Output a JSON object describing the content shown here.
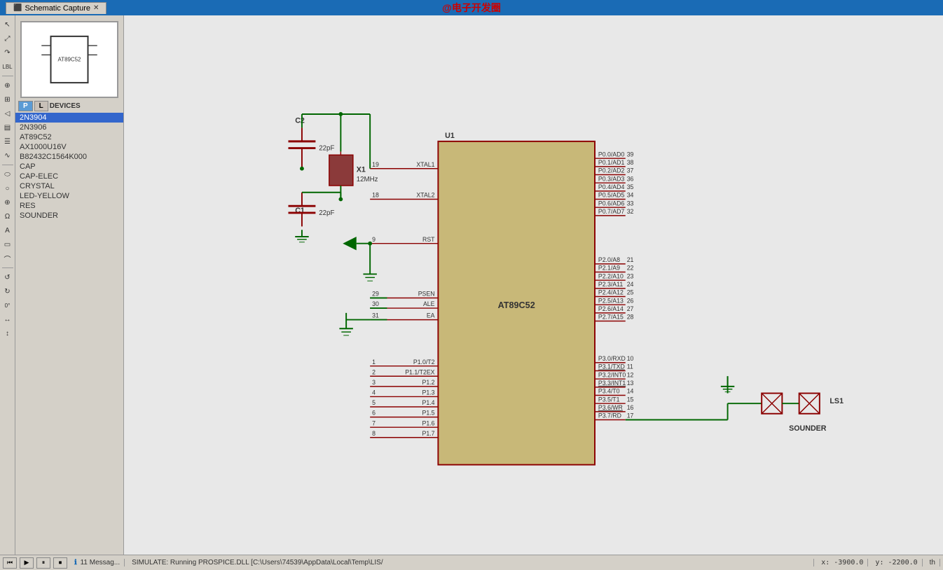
{
  "titlebar": {
    "tab_label": "Schematic Capture",
    "watermark": "@电子开发圈"
  },
  "sidebar": {
    "tab_p": "P",
    "tab_l": "L",
    "devices_label": "DEVICES",
    "devices": [
      {
        "name": "2N3904",
        "selected": true
      },
      {
        "name": "2N3906"
      },
      {
        "name": "AT89C52"
      },
      {
        "name": "AX1000U16V"
      },
      {
        "name": "B82432C1564K000"
      },
      {
        "name": "CAP"
      },
      {
        "name": "CAP-ELEC"
      },
      {
        "name": "CRYSTAL"
      },
      {
        "name": "LED-YELLOW"
      },
      {
        "name": "RES"
      },
      {
        "name": "SOUNDER"
      }
    ]
  },
  "schematic": {
    "ic_label": "U1",
    "ic_name": "AT89C52",
    "crystal_label": "X1",
    "crystal_freq": "12MHz",
    "cap_c1": "C1",
    "cap_c1_val": "22pF",
    "cap_c2": "C2",
    "cap_c2_val": "22pF",
    "sounder_label": "LS1",
    "sounder_name": "SOUNDER",
    "pins_left": [
      {
        "num": "19",
        "name": "XTAL1"
      },
      {
        "num": "18",
        "name": "XTAL2"
      },
      {
        "num": "9",
        "name": "RST"
      },
      {
        "num": "29",
        "name": "PSEN"
      },
      {
        "num": "30",
        "name": "ALE"
      },
      {
        "num": "31",
        "name": "EA"
      },
      {
        "num": "1",
        "name": "P1.0/T2"
      },
      {
        "num": "2",
        "name": "P1.1/T2EX"
      },
      {
        "num": "3",
        "name": "P1.2"
      },
      {
        "num": "4",
        "name": "P1.3"
      },
      {
        "num": "5",
        "name": "P1.4"
      },
      {
        "num": "6",
        "name": "P1.5"
      },
      {
        "num": "7",
        "name": "P1.6"
      },
      {
        "num": "8",
        "name": "P1.7"
      }
    ],
    "pins_right": [
      {
        "num": "39",
        "name": "P0.0/AD0"
      },
      {
        "num": "38",
        "name": "P0.1/AD1"
      },
      {
        "num": "37",
        "name": "P0.2/AD2"
      },
      {
        "num": "36",
        "name": "P0.3/AD3"
      },
      {
        "num": "35",
        "name": "P0.4/AD4"
      },
      {
        "num": "34",
        "name": "P0.5/AD5"
      },
      {
        "num": "33",
        "name": "P0.6/AD6"
      },
      {
        "num": "32",
        "name": "P0.7/AD7"
      },
      {
        "num": "21",
        "name": "P2.0/A8"
      },
      {
        "num": "22",
        "name": "P2.1/A9"
      },
      {
        "num": "23",
        "name": "P2.2/A10"
      },
      {
        "num": "24",
        "name": "P2.3/A11"
      },
      {
        "num": "25",
        "name": "P2.4/A12"
      },
      {
        "num": "26",
        "name": "P2.5/A13"
      },
      {
        "num": "27",
        "name": "P2.6/A14"
      },
      {
        "num": "28",
        "name": "P2.7/A15"
      },
      {
        "num": "10",
        "name": "P3.0/RXD"
      },
      {
        "num": "11",
        "name": "P3.1/TXD"
      },
      {
        "num": "12",
        "name": "P3.2/INT0"
      },
      {
        "num": "13",
        "name": "P3.3/INT1"
      },
      {
        "num": "14",
        "name": "P3.4/T0"
      },
      {
        "num": "15",
        "name": "P3.5/T1"
      },
      {
        "num": "16",
        "name": "P3.6/WR"
      },
      {
        "num": "17",
        "name": "P3.7/RD"
      }
    ]
  },
  "statusbar": {
    "messages": "11 Messag...",
    "simulate_text": "SIMULATE: Running PROSPICE.DLL [C:\\Users\\74539\\AppData\\Local\\Temp\\LIS/",
    "x_label": "x:",
    "x_val": "-3900.0",
    "y_label": "y:",
    "y_val": "-2200.0",
    "right_text": "th"
  },
  "tools": [
    "↖",
    "→",
    "↗",
    "LBL",
    "⊕",
    "⊞",
    "◁",
    "⊡",
    "☰",
    "∿",
    "⬭",
    "○",
    "⊕",
    "Ω",
    "A",
    "▭",
    "⌒",
    "↺",
    "↻",
    "0°",
    "↔",
    "↕"
  ]
}
